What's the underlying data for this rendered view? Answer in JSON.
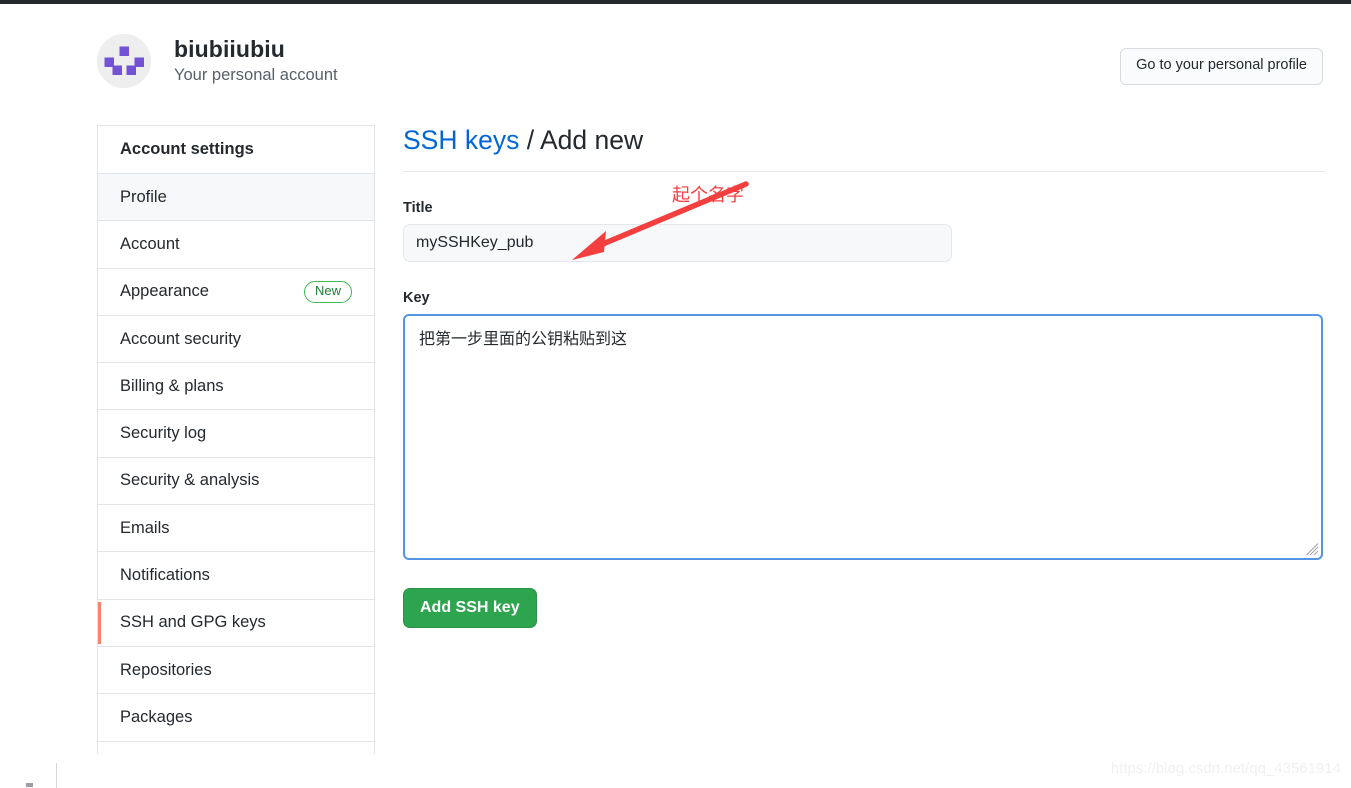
{
  "header": {
    "account_name": "biubiiubiu",
    "account_subtitle": "Your personal account",
    "avatar_icon": "identicon-avatar",
    "profile_button": "Go to your personal profile"
  },
  "sidebar": {
    "title": "Account settings",
    "items": [
      {
        "label": "Profile",
        "badge": "",
        "state": "hovered"
      },
      {
        "label": "Account",
        "badge": "",
        "state": ""
      },
      {
        "label": "Appearance",
        "badge": "New",
        "state": ""
      },
      {
        "label": "Account security",
        "badge": "",
        "state": ""
      },
      {
        "label": "Billing & plans",
        "badge": "",
        "state": ""
      },
      {
        "label": "Security log",
        "badge": "",
        "state": ""
      },
      {
        "label": "Security & analysis",
        "badge": "",
        "state": ""
      },
      {
        "label": "Emails",
        "badge": "",
        "state": ""
      },
      {
        "label": "Notifications",
        "badge": "",
        "state": ""
      },
      {
        "label": "SSH and GPG keys",
        "badge": "",
        "state": "active"
      },
      {
        "label": "Repositories",
        "badge": "",
        "state": ""
      },
      {
        "label": "Packages",
        "badge": "",
        "state": ""
      }
    ]
  },
  "main": {
    "title_link": "SSH keys",
    "title_separator": " / ",
    "title_current": "Add new",
    "title_label": "Title",
    "title_value": "mySSHKey_pub",
    "title_placeholder": "",
    "key_label": "Key",
    "key_value": "把第一步里面的公钥粘贴到这",
    "key_placeholder": "",
    "submit_label": "Add SSH key"
  },
  "annotation": {
    "text": "起个名字",
    "color": "#f43f3f",
    "arrow_icon": "red-arrow-icon"
  },
  "watermark": {
    "text": "https://blog.csdn.net/qq_43561914"
  },
  "colors": {
    "link_blue": "#0366d6",
    "button_green": "#2da44e",
    "badge_green": "#1a7f37",
    "active_orange": "#f9826c",
    "focus_blue": "#5296e3",
    "identicon_purple": "#7353d3"
  }
}
